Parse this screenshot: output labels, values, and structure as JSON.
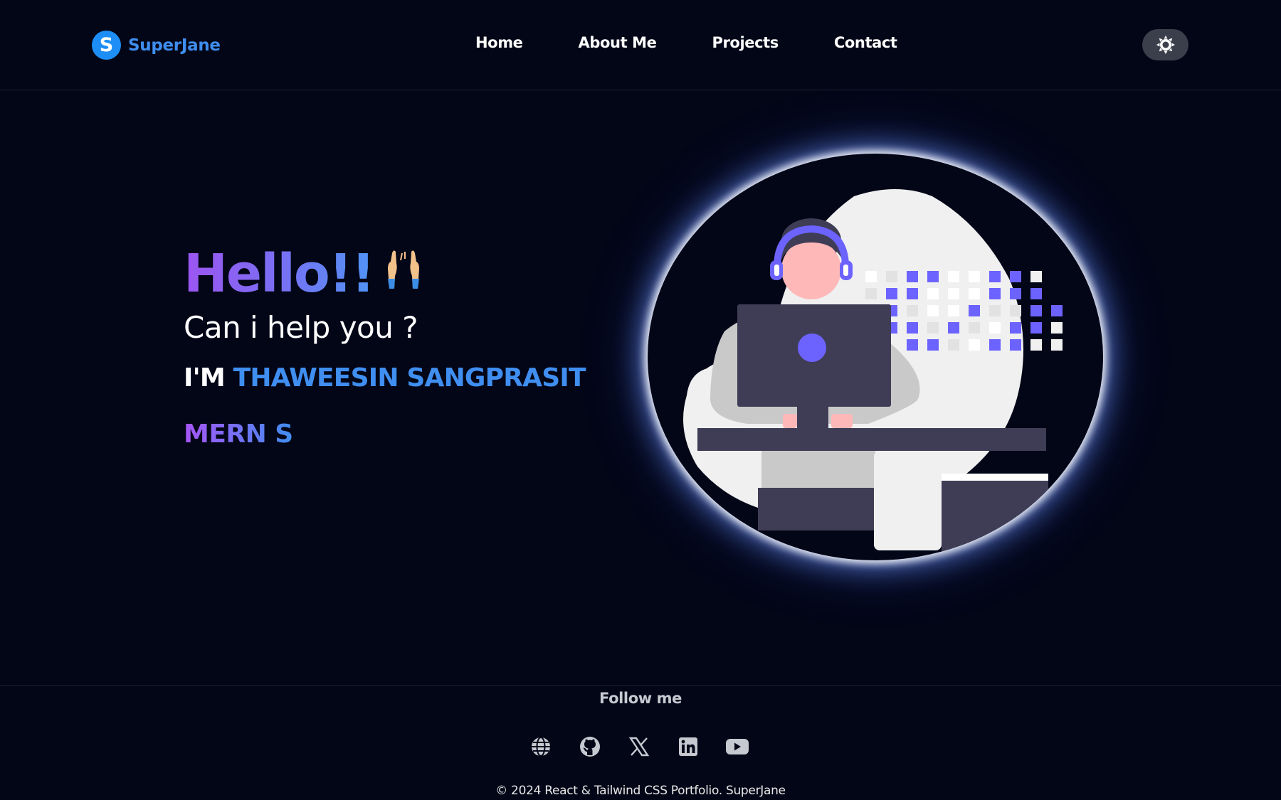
{
  "nav": {
    "brand_letter": "S",
    "brand_name": "SuperJane",
    "links": [
      {
        "label": "Home"
      },
      {
        "label": "About Me"
      },
      {
        "label": "Projects"
      },
      {
        "label": "Contact"
      }
    ],
    "theme_toggle_icon": "sun-icon"
  },
  "hero": {
    "greeting": "Hello!!",
    "greeting_icon": "raising-hands-emoji",
    "subtitle": "Can i help you ?",
    "im_prefix": "I'M",
    "name": "THAWEESIN SANGPRASIT",
    "role_typed": "MERN S",
    "illustration": "developer-at-computer-illustration"
  },
  "footer": {
    "follow_label": "Follow me",
    "social": [
      {
        "icon": "globe-icon"
      },
      {
        "icon": "github-icon"
      },
      {
        "icon": "x-twitter-icon"
      },
      {
        "icon": "linkedin-icon"
      },
      {
        "icon": "youtube-icon"
      }
    ],
    "copyright": "© 2024 React & Tailwind CSS Portfolio. SuperJane"
  },
  "colors": {
    "background": "#030617",
    "accent_blue": "#3f8ef0",
    "accent_purple": "#9d55f2",
    "illustration_purple": "#6c63ff"
  }
}
